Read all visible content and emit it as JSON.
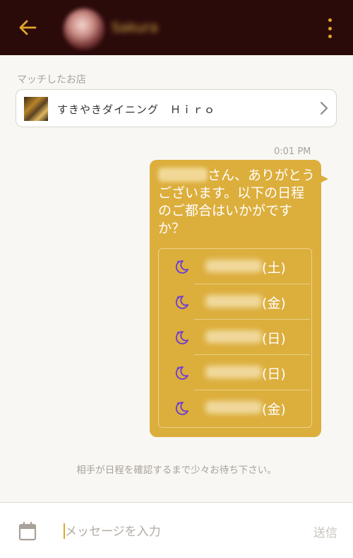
{
  "header": {
    "back_icon": "arrow-left-icon",
    "partner_name": "Sakura",
    "menu_icon": "more-vertical-icon"
  },
  "matched_shop": {
    "section_label": "マッチしたお店",
    "name": "すきやきダイニング　Ｈｉｒｏ",
    "chevron_icon": "chevron-right-icon"
  },
  "message": {
    "time": "0:01 PM",
    "greeting_rest": "さん、ありがとうございます。以下の日程のご都合はいかがですか？",
    "schedule": [
      {
        "icon": "moon-icon",
        "day": "(土)"
      },
      {
        "icon": "moon-icon",
        "day": "(金)"
      },
      {
        "icon": "moon-icon",
        "day": "(日)"
      },
      {
        "icon": "moon-icon",
        "day": "(日)"
      },
      {
        "icon": "moon-icon",
        "day": "(金)"
      }
    ]
  },
  "status_note": "相手が日程を確認するまで少々お待ち下さい。",
  "composer": {
    "calendar_icon": "calendar-icon",
    "placeholder": "メッセージを入力",
    "send_label": "送信"
  },
  "colors": {
    "header_bg": "#2b0a0a",
    "accent": "#e0a52b",
    "bubble": "#dcae3c",
    "moon": "#6b3bd9"
  }
}
